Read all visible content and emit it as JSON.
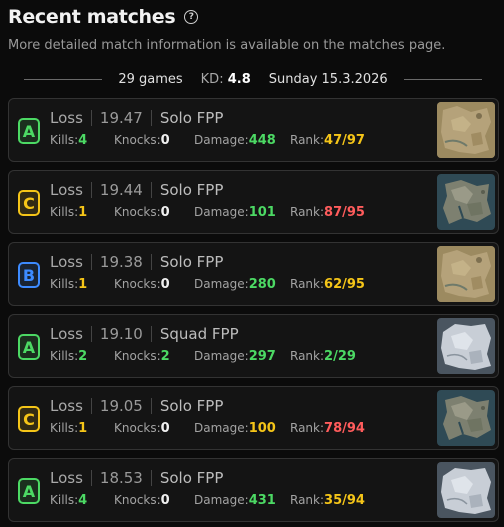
{
  "header": {
    "title": "Recent matches",
    "help_icon": "?"
  },
  "subtitle": "More detailed match information is available on the matches page.",
  "summary": {
    "games": "29 games",
    "kd_label": "KD:",
    "kd_value": "4.8",
    "date": "Sunday 15.3.2026"
  },
  "labels": {
    "kills": "Kills:",
    "knocks": "Knocks:",
    "damage": "Damage:",
    "rank": "Rank:"
  },
  "colors": {
    "green": "#4cd964",
    "yellow": "#f5c518",
    "blue": "#3d8bff",
    "red": "#ff5c5c",
    "white": "#f0f0f0"
  },
  "matches": [
    {
      "grade": "A",
      "grade_color": "#4cd964",
      "result": "Loss",
      "time": "19.47",
      "mode": "Solo FPP",
      "kills": "4",
      "kills_color": "#4cd964",
      "knocks": "0",
      "knocks_color": "#f0f0f0",
      "damage": "448",
      "damage_color": "#4cd964",
      "rank": "47/97",
      "rank_color": "#f5c518",
      "map": "desert"
    },
    {
      "grade": "C",
      "grade_color": "#f5c518",
      "result": "Loss",
      "time": "19.44",
      "mode": "Solo FPP",
      "kills": "1",
      "kills_color": "#f5c518",
      "knocks": "0",
      "knocks_color": "#f0f0f0",
      "damage": "101",
      "damage_color": "#4cd964",
      "rank": "87/95",
      "rank_color": "#ff5c5c",
      "map": "island"
    },
    {
      "grade": "B",
      "grade_color": "#3d8bff",
      "result": "Loss",
      "time": "19.38",
      "mode": "Solo FPP",
      "kills": "1",
      "kills_color": "#f5c518",
      "knocks": "0",
      "knocks_color": "#f0f0f0",
      "damage": "280",
      "damage_color": "#4cd964",
      "rank": "62/95",
      "rank_color": "#f5c518",
      "map": "desert"
    },
    {
      "grade": "A",
      "grade_color": "#4cd964",
      "result": "Loss",
      "time": "19.10",
      "mode": "Squad FPP",
      "kills": "2",
      "kills_color": "#4cd964",
      "knocks": "2",
      "knocks_color": "#4cd964",
      "damage": "297",
      "damage_color": "#4cd964",
      "rank": "2/29",
      "rank_color": "#4cd964",
      "map": "snow"
    },
    {
      "grade": "C",
      "grade_color": "#f5c518",
      "result": "Loss",
      "time": "19.05",
      "mode": "Solo FPP",
      "kills": "1",
      "kills_color": "#f5c518",
      "knocks": "0",
      "knocks_color": "#f0f0f0",
      "damage": "100",
      "damage_color": "#f5c518",
      "rank": "78/94",
      "rank_color": "#ff5c5c",
      "map": "island"
    },
    {
      "grade": "A",
      "grade_color": "#4cd964",
      "result": "Loss",
      "time": "18.53",
      "mode": "Solo FPP",
      "kills": "4",
      "kills_color": "#4cd964",
      "knocks": "0",
      "knocks_color": "#f0f0f0",
      "damage": "431",
      "damage_color": "#4cd964",
      "rank": "35/94",
      "rank_color": "#f5c518",
      "map": "snow"
    }
  ]
}
